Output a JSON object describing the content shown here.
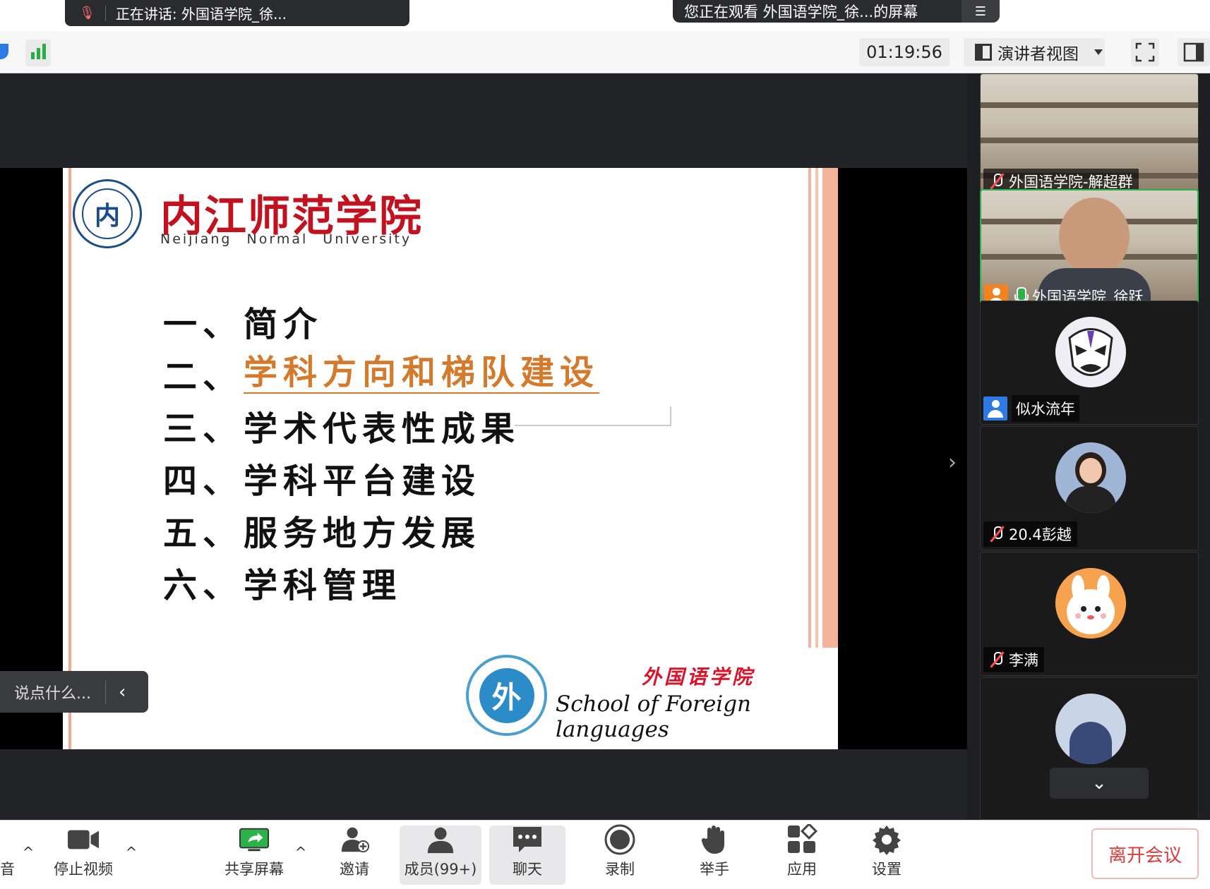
{
  "banners": {
    "speaking": "正在讲话: 外国语学院_徐...",
    "viewing": "您正在观看 外国语学院_徐...的屏幕"
  },
  "toolbar": {
    "timer": "01:19:56",
    "view_mode": "演讲者视图"
  },
  "slide": {
    "university_zh": "内江师范学院",
    "university_en": "Neijiang Normal University",
    "toc": [
      {
        "num": "一、",
        "text": "简介"
      },
      {
        "num": "二、",
        "text": "学科方向和梯队建设"
      },
      {
        "num": "三、",
        "text": "学术代表性成果"
      },
      {
        "num": "四、",
        "text": "学科平台建设"
      },
      {
        "num": "五、",
        "text": "服务地方发展"
      },
      {
        "num": "六、",
        "text": "学科管理"
      }
    ],
    "school_zh": "外国语学院",
    "school_en": "School of Foreign languages"
  },
  "comment": {
    "placeholder": "说点什么..."
  },
  "participants": [
    {
      "name": "外国语学院-解超群",
      "mic": "off"
    },
    {
      "name": "外国语学院_徐跃",
      "mic": "on"
    },
    {
      "name": "似水流年",
      "mic": "none"
    },
    {
      "name": "20.4彭越",
      "mic": "off"
    },
    {
      "name": "李满",
      "mic": "off"
    }
  ],
  "bottom": {
    "audio": "音",
    "stop_video": "停止视频",
    "share_screen": "共享屏幕",
    "invite": "邀请",
    "members": "成员(99+)",
    "chat": "聊天",
    "record": "录制",
    "raise_hand": "举手",
    "apps": "应用",
    "settings": "设置",
    "leave": "离开会议"
  },
  "colors": {
    "accent_green": "#2bb34a",
    "slide_highlight": "#d47a2c",
    "university_red": "#c3121f",
    "leave_red": "#e03a3a"
  }
}
